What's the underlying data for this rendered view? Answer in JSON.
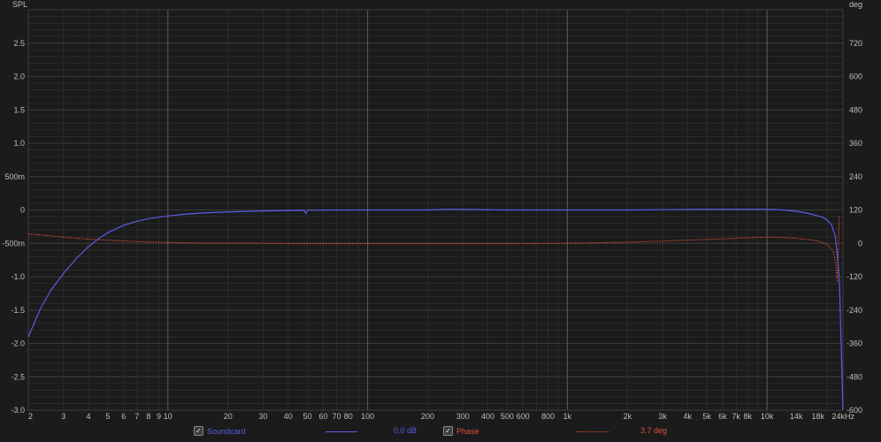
{
  "chart_data": {
    "type": "line",
    "left_axis_label": "SPL",
    "right_axis_label": "deg",
    "x_scale": "log",
    "xlim": [
      2,
      24000
    ],
    "ylim": [
      -3.0,
      3.0
    ],
    "y2lim": [
      -600,
      840
    ],
    "x_ticks": [
      {
        "v": 2,
        "label": "2"
      },
      {
        "v": 3,
        "label": "3"
      },
      {
        "v": 4,
        "label": "4"
      },
      {
        "v": 5,
        "label": "5"
      },
      {
        "v": 6,
        "label": "6"
      },
      {
        "v": 7,
        "label": "7"
      },
      {
        "v": 8,
        "label": "8"
      },
      {
        "v": 9,
        "label": "9"
      },
      {
        "v": 10,
        "label": "10"
      },
      {
        "v": 20,
        "label": "20"
      },
      {
        "v": 30,
        "label": "30"
      },
      {
        "v": 40,
        "label": "40"
      },
      {
        "v": 50,
        "label": "50"
      },
      {
        "v": 60,
        "label": "60"
      },
      {
        "v": 70,
        "label": "70"
      },
      {
        "v": 80,
        "label": "80"
      },
      {
        "v": 100,
        "label": "100"
      },
      {
        "v": 200,
        "label": "200"
      },
      {
        "v": 300,
        "label": "300"
      },
      {
        "v": 400,
        "label": "400"
      },
      {
        "v": 500,
        "label": "500"
      },
      {
        "v": 600,
        "label": "600"
      },
      {
        "v": 800,
        "label": "800"
      },
      {
        "v": 1000,
        "label": "1k"
      },
      {
        "v": 2000,
        "label": "2k"
      },
      {
        "v": 3000,
        "label": "3k"
      },
      {
        "v": 4000,
        "label": "4k"
      },
      {
        "v": 5000,
        "label": "5k"
      },
      {
        "v": 6000,
        "label": "6k"
      },
      {
        "v": 7000,
        "label": "7k"
      },
      {
        "v": 8000,
        "label": "8k"
      },
      {
        "v": 10000,
        "label": "10k"
      },
      {
        "v": 14000,
        "label": "14k"
      },
      {
        "v": 18000,
        "label": "18k"
      },
      {
        "v": 24000,
        "label": "24kHz"
      }
    ],
    "y_ticks": [
      {
        "v": 2.5,
        "label": "2.5"
      },
      {
        "v": 2.0,
        "label": "2.0"
      },
      {
        "v": 1.5,
        "label": "1.5"
      },
      {
        "v": 1.0,
        "label": "1.0"
      },
      {
        "v": 0.5,
        "label": "500m"
      },
      {
        "v": 0,
        "label": "0"
      },
      {
        "v": -0.5,
        "label": "-500m"
      },
      {
        "v": -1.0,
        "label": "-1.0"
      },
      {
        "v": -1.5,
        "label": "-1.5"
      },
      {
        "v": -2.0,
        "label": "-2.0"
      },
      {
        "v": -2.5,
        "label": "-2.5"
      },
      {
        "v": -3.0,
        "label": "-3.0"
      }
    ],
    "y2_ticks": [
      {
        "v": 720,
        "label": "720"
      },
      {
        "v": 600,
        "label": "600"
      },
      {
        "v": 480,
        "label": "480"
      },
      {
        "v": 360,
        "label": "360"
      },
      {
        "v": 240,
        "label": "240"
      },
      {
        "v": 120,
        "label": "120"
      },
      {
        "v": 0,
        "label": "0"
      },
      {
        "v": -120,
        "label": "-120"
      },
      {
        "v": -240,
        "label": "-240"
      },
      {
        "v": -360,
        "label": "-360"
      },
      {
        "v": -480,
        "label": "-480"
      },
      {
        "v": -600,
        "label": "-600"
      }
    ],
    "grid": true,
    "series": [
      {
        "name": "Soundcard",
        "axis": "left",
        "color": "#5b5be6",
        "x": [
          2,
          2.3,
          2.6,
          3,
          3.5,
          4,
          4.5,
          5,
          6,
          7,
          8,
          10,
          12,
          15,
          20,
          30,
          40,
          48,
          49,
          50,
          60,
          100,
          200,
          250,
          500,
          1000,
          2000,
          5000,
          8000,
          10000,
          12000,
          14000,
          16000,
          18000,
          19000,
          20000,
          21000,
          22000,
          23000,
          23500,
          24000
        ],
        "y": [
          -1.9,
          -1.48,
          -1.2,
          -0.95,
          -0.72,
          -0.55,
          -0.43,
          -0.34,
          -0.23,
          -0.17,
          -0.13,
          -0.09,
          -0.065,
          -0.045,
          -0.03,
          -0.015,
          -0.008,
          -0.005,
          -0.05,
          -0.004,
          -0.002,
          0.0,
          0.0,
          0.01,
          0.0,
          0.0,
          0.0,
          0.01,
          0.01,
          0.01,
          0.0,
          -0.02,
          -0.05,
          -0.09,
          -0.11,
          -0.15,
          -0.22,
          -0.4,
          -1.0,
          -2.0,
          -3.0
        ]
      },
      {
        "name": "Phase",
        "axis": "right",
        "color": "#e0503c",
        "dashed": true,
        "x": [
          2,
          2.5,
          3,
          4,
          5,
          7,
          10,
          15,
          20,
          30,
          50,
          100,
          200,
          500,
          1000,
          2000,
          3000,
          5000,
          8000,
          10000,
          12000,
          14000,
          16000,
          18000,
          20000,
          21500,
          22000,
          22500,
          23000
        ],
        "y": [
          34,
          28,
          22,
          15,
          11,
          6,
          3,
          1,
          0.5,
          0,
          -1,
          -1,
          -1,
          -1,
          0,
          4,
          8,
          14,
          20,
          22,
          21,
          18,
          14,
          8,
          -4,
          -30,
          -70,
          -140,
          100
        ]
      }
    ],
    "legend": {
      "placement": "bottom",
      "items": [
        {
          "label": "Soundcard",
          "checked": true,
          "color": "#5b5be6",
          "readout": "0.0 dB"
        },
        {
          "label": "Phase",
          "checked": true,
          "color": "#e0503c",
          "readout": "3.7 deg"
        }
      ]
    }
  }
}
